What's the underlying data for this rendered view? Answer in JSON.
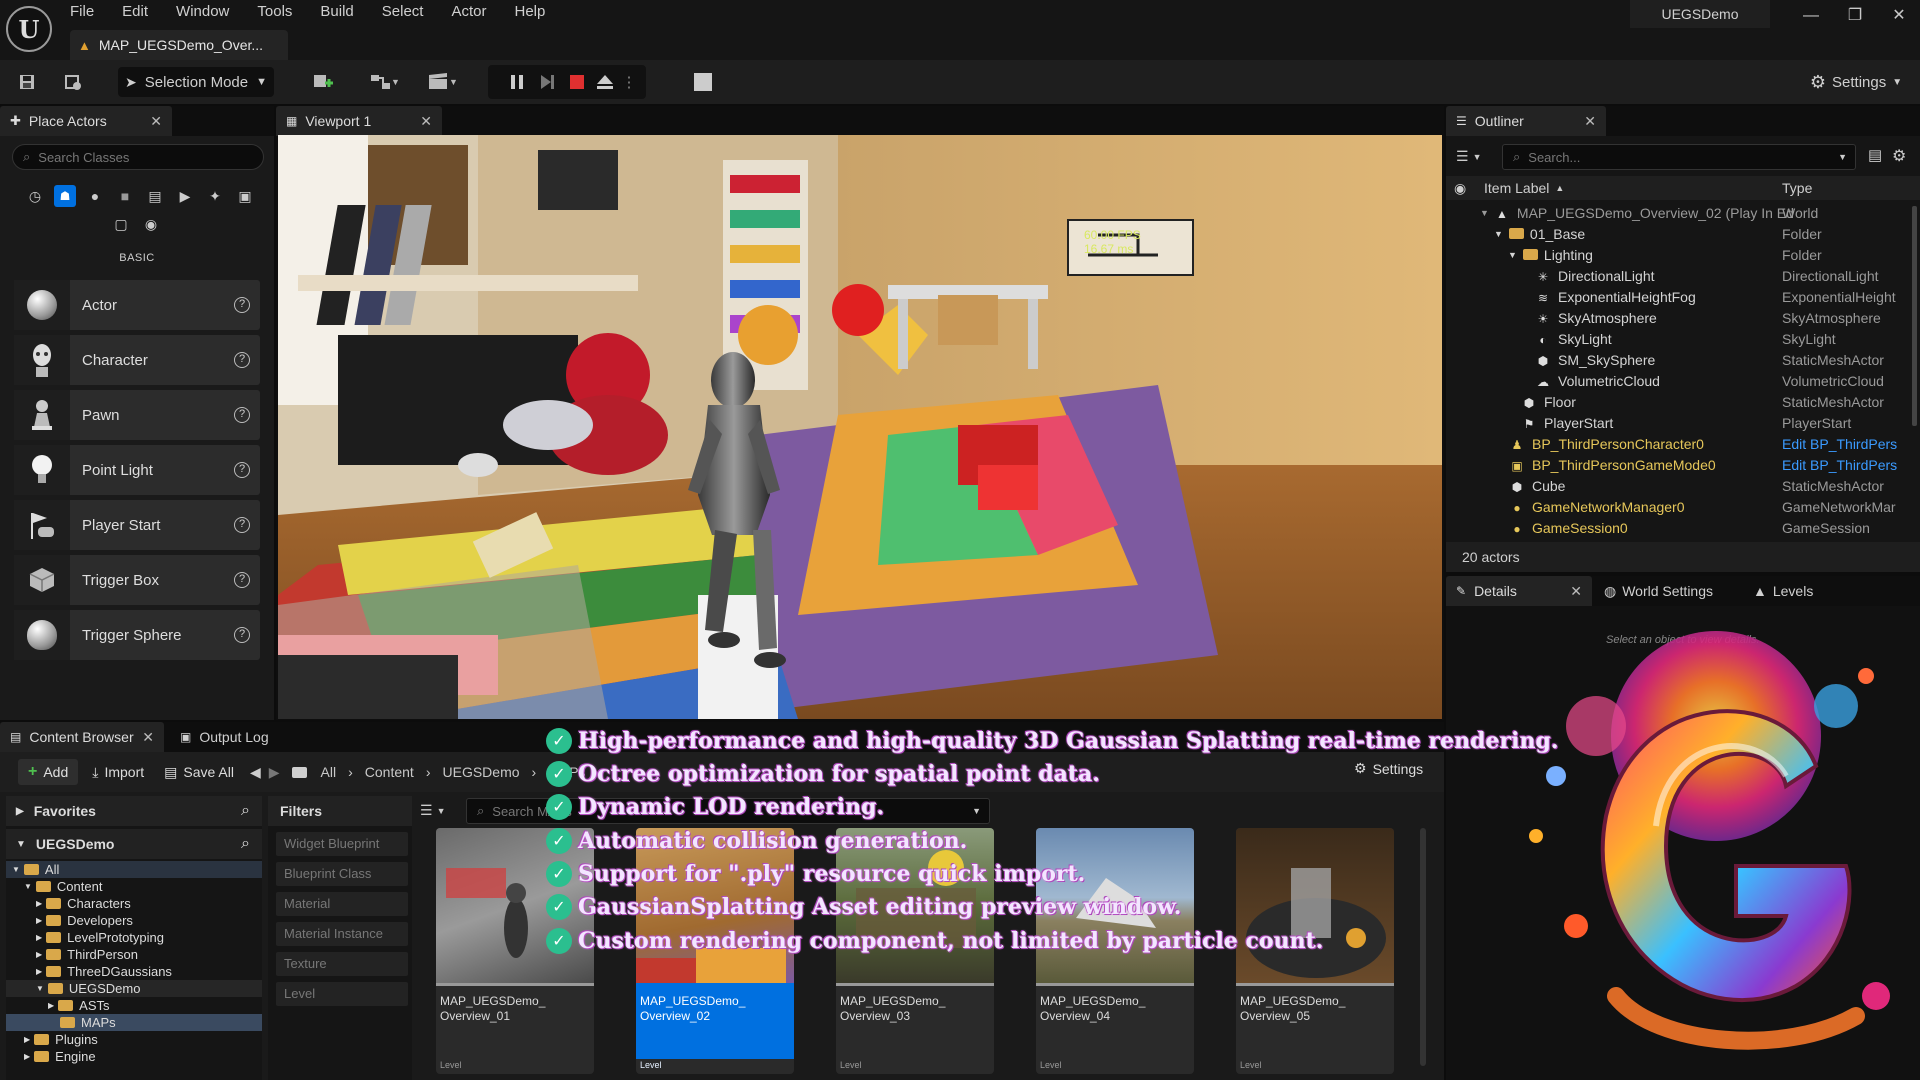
{
  "menu": [
    "File",
    "Edit",
    "Window",
    "Tools",
    "Build",
    "Select",
    "Actor",
    "Help"
  ],
  "document_tab": "MAP_UEGSDemo_Over...",
  "project_name": "UEGSDemo",
  "toolbar": {
    "selection_mode": "Selection Mode",
    "settings": "Settings"
  },
  "place_actors": {
    "tab": "Place Actors",
    "search_placeholder": "Search Classes",
    "section": "BASIC",
    "items": [
      "Actor",
      "Character",
      "Pawn",
      "Point Light",
      "Player Start",
      "Trigger Box",
      "Trigger Sphere"
    ]
  },
  "viewport": {
    "tab": "Viewport 1",
    "fps": "60.00 FPS",
    "ms": "16.67 ms"
  },
  "outliner": {
    "tab": "Outliner",
    "search_placeholder": "Search...",
    "col_label": "Item Label",
    "col_type": "Type",
    "rows": [
      {
        "label": "MAP_UEGSDemo_Overview_02 (Play In Ed",
        "type": "World"
      },
      {
        "label": "01_Base",
        "type": "Folder"
      },
      {
        "label": "Lighting",
        "type": "Folder"
      },
      {
        "label": "DirectionalLight",
        "type": "DirectionalLight"
      },
      {
        "label": "ExponentialHeightFog",
        "type": "ExponentialHeight"
      },
      {
        "label": "SkyAtmosphere",
        "type": "SkyAtmosphere"
      },
      {
        "label": "SkyLight",
        "type": "SkyLight"
      },
      {
        "label": "SM_SkySphere",
        "type": "StaticMeshActor"
      },
      {
        "label": "VolumetricCloud",
        "type": "VolumetricCloud"
      },
      {
        "label": "Floor",
        "type": "StaticMeshActor"
      },
      {
        "label": "PlayerStart",
        "type": "PlayerStart"
      },
      {
        "label": "BP_ThirdPersonCharacter0",
        "type": "Edit BP_ThirdPers"
      },
      {
        "label": "BP_ThirdPersonGameMode0",
        "type": "Edit BP_ThirdPers"
      },
      {
        "label": "Cube",
        "type": "StaticMeshActor"
      },
      {
        "label": "GameNetworkManager0",
        "type": "GameNetworkMar"
      },
      {
        "label": "GameSession0",
        "type": "GameSession"
      }
    ],
    "count": "20 actors"
  },
  "details": {
    "tab_details": "Details",
    "tab_world": "World Settings",
    "tab_levels": "Levels",
    "hint": "Select an object to view details."
  },
  "content_browser": {
    "tab": "Content Browser",
    "tab_log": "Output Log",
    "add": "Add",
    "import": "Import",
    "save_all": "Save All",
    "crumbs": [
      "All",
      "Content",
      "UEGSDemo",
      "MAPs"
    ],
    "settings": "Settings",
    "favorites": "Favorites",
    "project": "UEGSDemo",
    "tree": [
      "All",
      "Content",
      "Characters",
      "Developers",
      "LevelPrototyping",
      "ThirdPerson",
      "ThreeDGaussians",
      "UEGSDemo",
      "ASTs",
      "MAPs",
      "Plugins",
      "Engine"
    ],
    "filters_title": "Filters",
    "filters": [
      "Widget Blueprint",
      "Blueprint Class",
      "Material",
      "Material Instance",
      "Texture",
      "Level"
    ],
    "search_placeholder": "Search MAPs",
    "assets": [
      {
        "line1": "MAP_UEGSDemo_",
        "line2": "Overview_01",
        "kind": "Level"
      },
      {
        "line1": "MAP_UEGSDemo_",
        "line2": "Overview_02",
        "kind": "Level"
      },
      {
        "line1": "MAP_UEGSDemo_",
        "line2": "Overview_03",
        "kind": "Level"
      },
      {
        "line1": "MAP_UEGSDemo_",
        "line2": "Overview_04",
        "kind": "Level"
      },
      {
        "line1": "MAP_UEGSDemo_",
        "line2": "Overview_05",
        "kind": "Level"
      }
    ]
  },
  "features": [
    "High-performance and high-quality 3D Gaussian Splatting real-time rendering.",
    "Octree optimization for spatial point data.",
    "Dynamic LOD rendering.",
    "Automatic collision generation.",
    "Support for \".ply\" resource quick import.",
    "GaussianSplatting Asset editing  preview window.",
    "Custom rendering component, not limited by particle count."
  ],
  "colors": {
    "accent": "#0070e0",
    "link": "#3b9bff",
    "check": "#2bbf8f",
    "record": "#e03030"
  }
}
